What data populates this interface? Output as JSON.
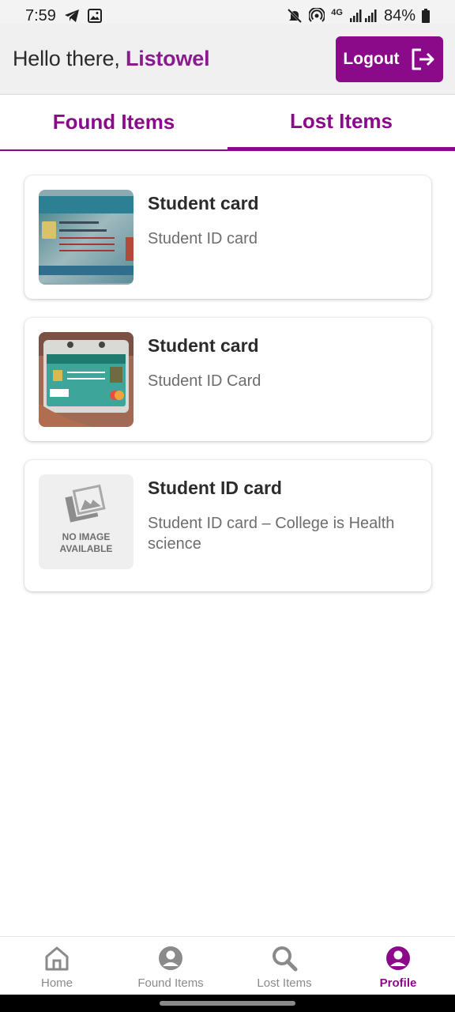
{
  "status_bar": {
    "time": "7:59",
    "network": "4G",
    "battery": "84%",
    "icons": [
      "telegram-icon",
      "gallery-icon",
      "mute-icon",
      "hotspot-icon",
      "signal-icon",
      "battery-icon"
    ]
  },
  "header": {
    "greeting": "Hello there,",
    "username": "Listowel",
    "logout_label": "Logout"
  },
  "tabs": [
    {
      "label": "Found Items",
      "active": false
    },
    {
      "label": "Lost Items",
      "active": true
    }
  ],
  "items": [
    {
      "title": "Student card",
      "description": "Student ID card",
      "image": "photo"
    },
    {
      "title": "Student card",
      "description": "Student ID Card",
      "image": "photo"
    },
    {
      "title": "Student ID card",
      "description": "Student ID card – College is Health science",
      "image": "NO IMAGE AVAILABLE"
    }
  ],
  "bottom_nav": [
    {
      "label": "Home",
      "icon": "home-icon",
      "active": false
    },
    {
      "label": "Found Items",
      "icon": "user-circle-icon",
      "active": false
    },
    {
      "label": "Lost Items",
      "icon": "search-icon",
      "active": false
    },
    {
      "label": "Profile",
      "icon": "profile-icon",
      "active": true
    }
  ],
  "colors": {
    "accent": "#8a0a8a",
    "header_bg": "#f0f0f0",
    "text": "#2b2b2b",
    "muted_text": "#6d6d6d"
  }
}
